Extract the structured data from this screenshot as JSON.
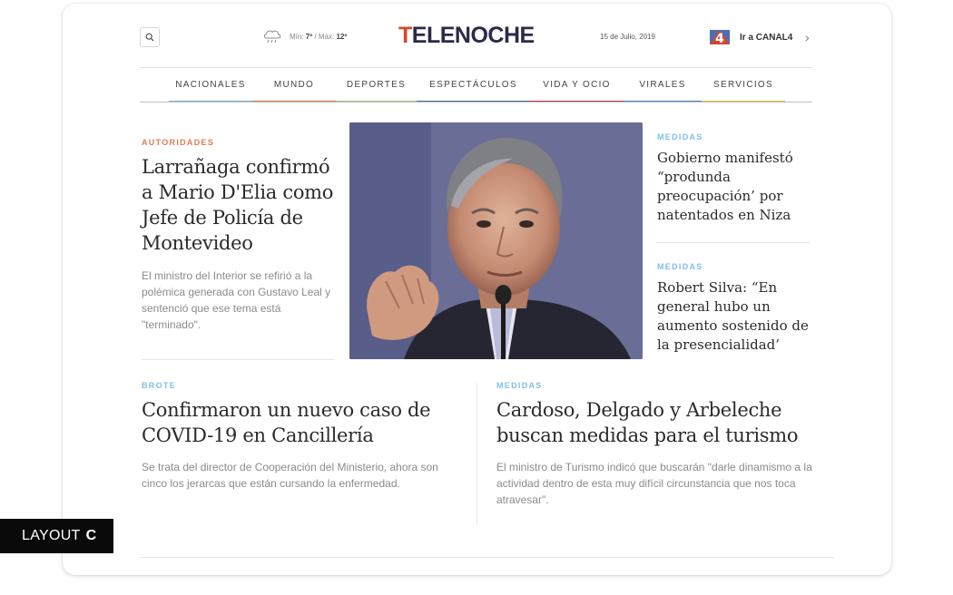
{
  "header": {
    "weather": {
      "min_label": "Mín:",
      "min_value": "7º",
      "separator": "/",
      "max_label": "Máx:",
      "max_value": "12º",
      "icon": "cloud-rain-icon"
    },
    "logo": {
      "first_letter": "T",
      "rest": "ELENOCHE",
      "accent_color": "#d4472b"
    },
    "date": "15 de Julio, 2019",
    "canal_link": "Ir a CANAL4",
    "canal_logo_text": "4"
  },
  "nav": {
    "items": [
      {
        "label": "NACIONALES",
        "color": "#7db0dd"
      },
      {
        "label": "MUNDO",
        "color": "#d3793f"
      },
      {
        "label": "DEPORTES",
        "color": "#9ac483"
      },
      {
        "label": "ESPECTÁCULOS",
        "color": "#4e6a9a"
      },
      {
        "label": "VIDA Y OCIO",
        "color": "#c9364a"
      },
      {
        "label": "VIRALES",
        "color": "#4e7fc4"
      },
      {
        "label": "SERVICIOS",
        "color": "#e1b84c"
      }
    ]
  },
  "articles": {
    "lead": {
      "kicker": "AUTORIDADES",
      "title": "Larrañaga confirmó a Mario D'Elia como Jefe de Policía de Montevideo",
      "summary": "El ministro del Interior se refirió a la polémica generada con Gustavo Leal y sentenció que ese tema está \"terminado\"."
    },
    "side1": {
      "kicker": "MEDIDAS",
      "title": "Gobierno manifestó “produnda preocupación’ por natentados en Niza"
    },
    "side2": {
      "kicker": "MEDIDAS",
      "title": "Robert Silva: “En general hubo un aumento sostenido de la presencialidad’"
    },
    "bottom_left": {
      "kicker": "BROTE",
      "title": "Confirmaron un nuevo caso de COVID-19 en Cancillería",
      "summary": "Se trata del director de Cooperación del Ministerio, ahora son cinco los jerarcas que están cursando la enfermedad."
    },
    "bottom_right": {
      "kicker": "MEDIDAS",
      "title": "Cardoso, Delgado y Arbeleche buscan medidas para el turismo",
      "summary": "El ministro de Turismo indicó que buscarán \"darle dinamismo a la actividad dentro de esta muy difícil circunstancia que nos toca atravesar\"."
    }
  },
  "badge": {
    "label": "LAYOUT",
    "letter": "C"
  }
}
